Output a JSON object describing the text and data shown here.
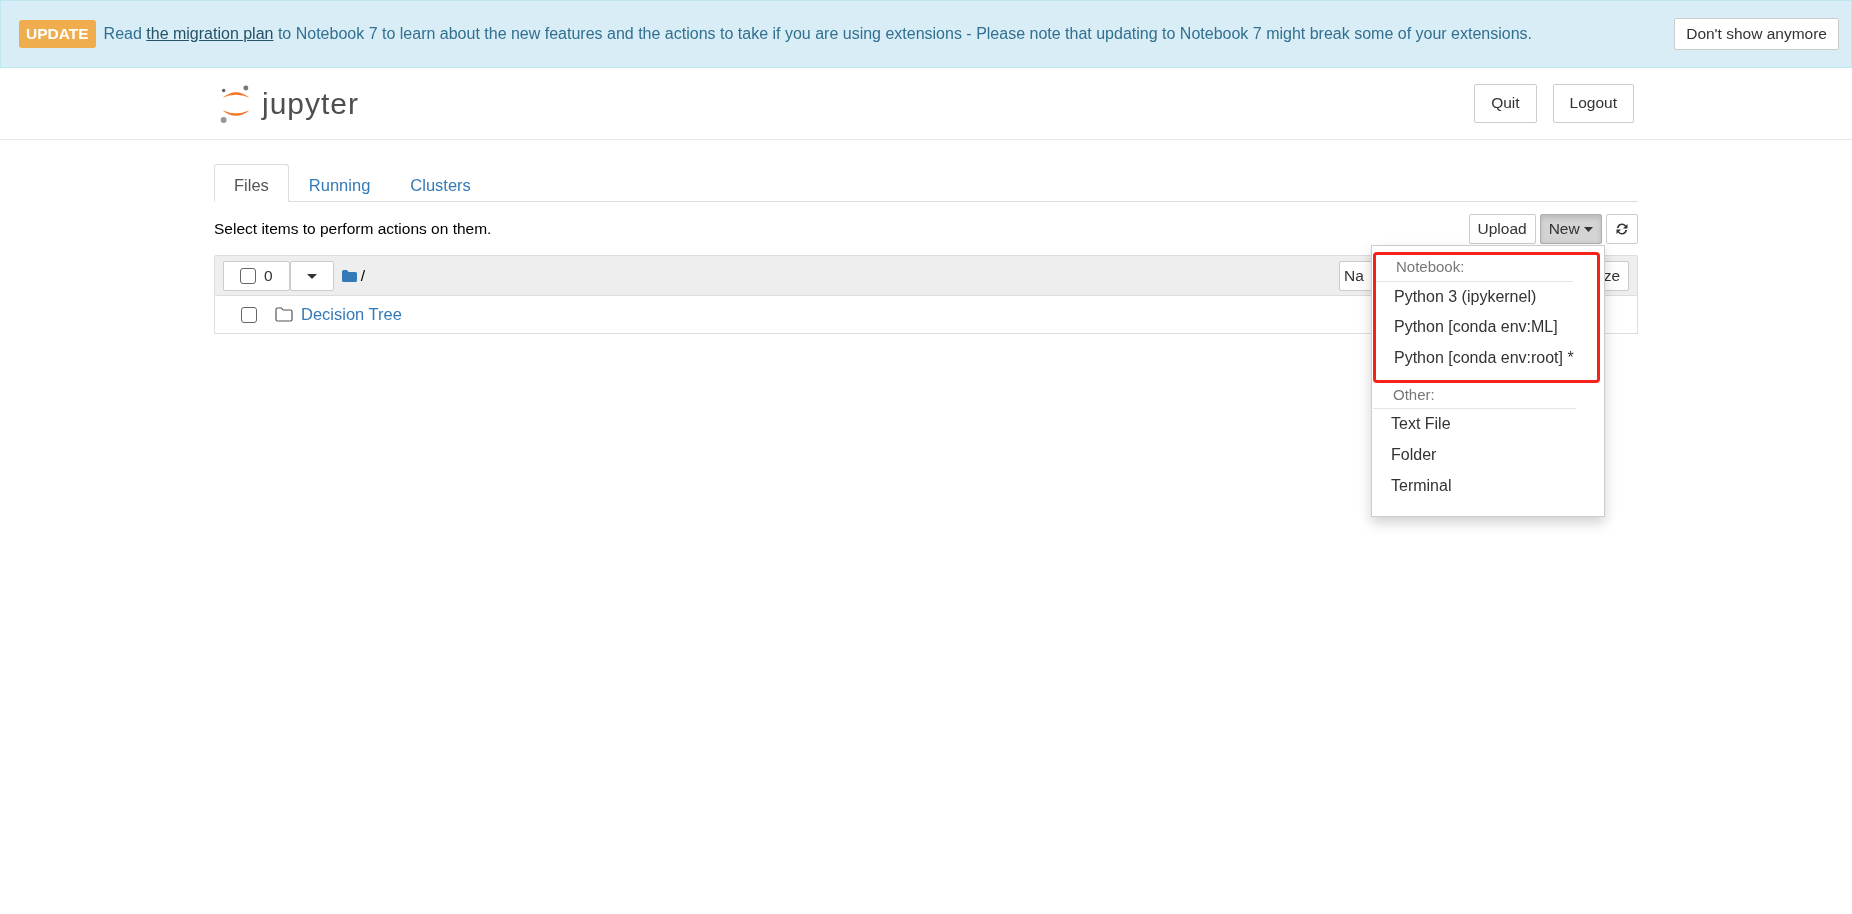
{
  "banner": {
    "badge": "UPDATE",
    "lead": "Read",
    "link": "the migration plan",
    "message": "to Notebook 7 to learn about the new features and the actions to take if you are using extensions - Please note that updating to Notebook 7 might break some of your extensions.",
    "dismiss": "Don't show anymore"
  },
  "header": {
    "logo_text": "jupyter",
    "buttons": [
      "Quit",
      "Logout"
    ]
  },
  "tabs": [
    {
      "label": "Files",
      "selected": true
    },
    {
      "label": "Running",
      "selected": false
    },
    {
      "label": "Clusters",
      "selected": false
    }
  ],
  "hint": "Select items to perform actions on them.",
  "toolbar": {
    "upload": "Upload",
    "new": "New",
    "new_open": true
  },
  "list_header": {
    "selected_count": "0",
    "path": "/",
    "sort_buttons": [
      "Na",
      "ze"
    ]
  },
  "items": [
    {
      "kind": "folder",
      "name": "Decision Tree",
      "checked": false
    }
  ],
  "new_menu": {
    "sections": [
      {
        "heading": "Notebook:",
        "highlighted": true,
        "items": [
          "Python 3 (ipykernel)",
          "Python [conda env:ML]",
          "Python [conda env:root] *"
        ]
      },
      {
        "heading": "Other:",
        "highlighted": false,
        "items": [
          "Text File",
          "Folder",
          "Terminal"
        ]
      }
    ]
  }
}
